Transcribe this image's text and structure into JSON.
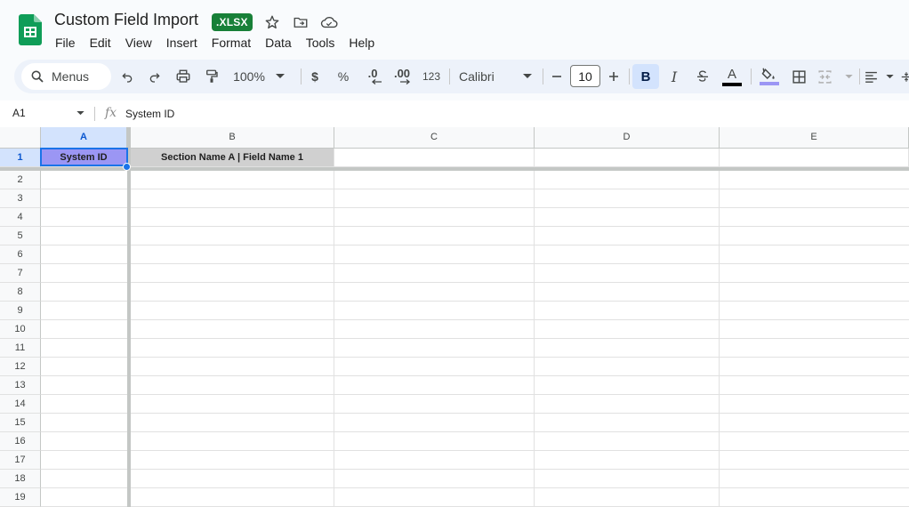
{
  "document": {
    "title": "Custom Field Import",
    "format_badge": ".XLSX"
  },
  "menu": [
    "File",
    "Edit",
    "View",
    "Insert",
    "Format",
    "Data",
    "Tools",
    "Help"
  ],
  "toolbar": {
    "search_label": "Menus",
    "zoom": "100%",
    "currency": "$",
    "percent": "%",
    "decrease_decimal": ".0",
    "increase_decimal": ".00",
    "number_format": "123",
    "font": "Calibri",
    "font_size": "10",
    "bold": "B",
    "italic": "I",
    "text_color_label": "A"
  },
  "formula_bar": {
    "cell_ref": "A1",
    "fx": "fx",
    "value": "System ID"
  },
  "grid": {
    "columns": [
      "A",
      "B",
      "C",
      "D",
      "E"
    ],
    "rows": [
      "1",
      "2",
      "3",
      "4",
      "5",
      "6",
      "7",
      "8",
      "9",
      "10",
      "11",
      "12",
      "13",
      "14",
      "15",
      "16",
      "17",
      "18",
      "19"
    ],
    "row1": [
      "System ID",
      "Section Name A | Field Name 1"
    ],
    "colors": {
      "a1_fill": "#9b96f4",
      "b1_fill": "#d0d0d0",
      "selection": "#1a73e8",
      "brand_green": "#188038"
    }
  }
}
